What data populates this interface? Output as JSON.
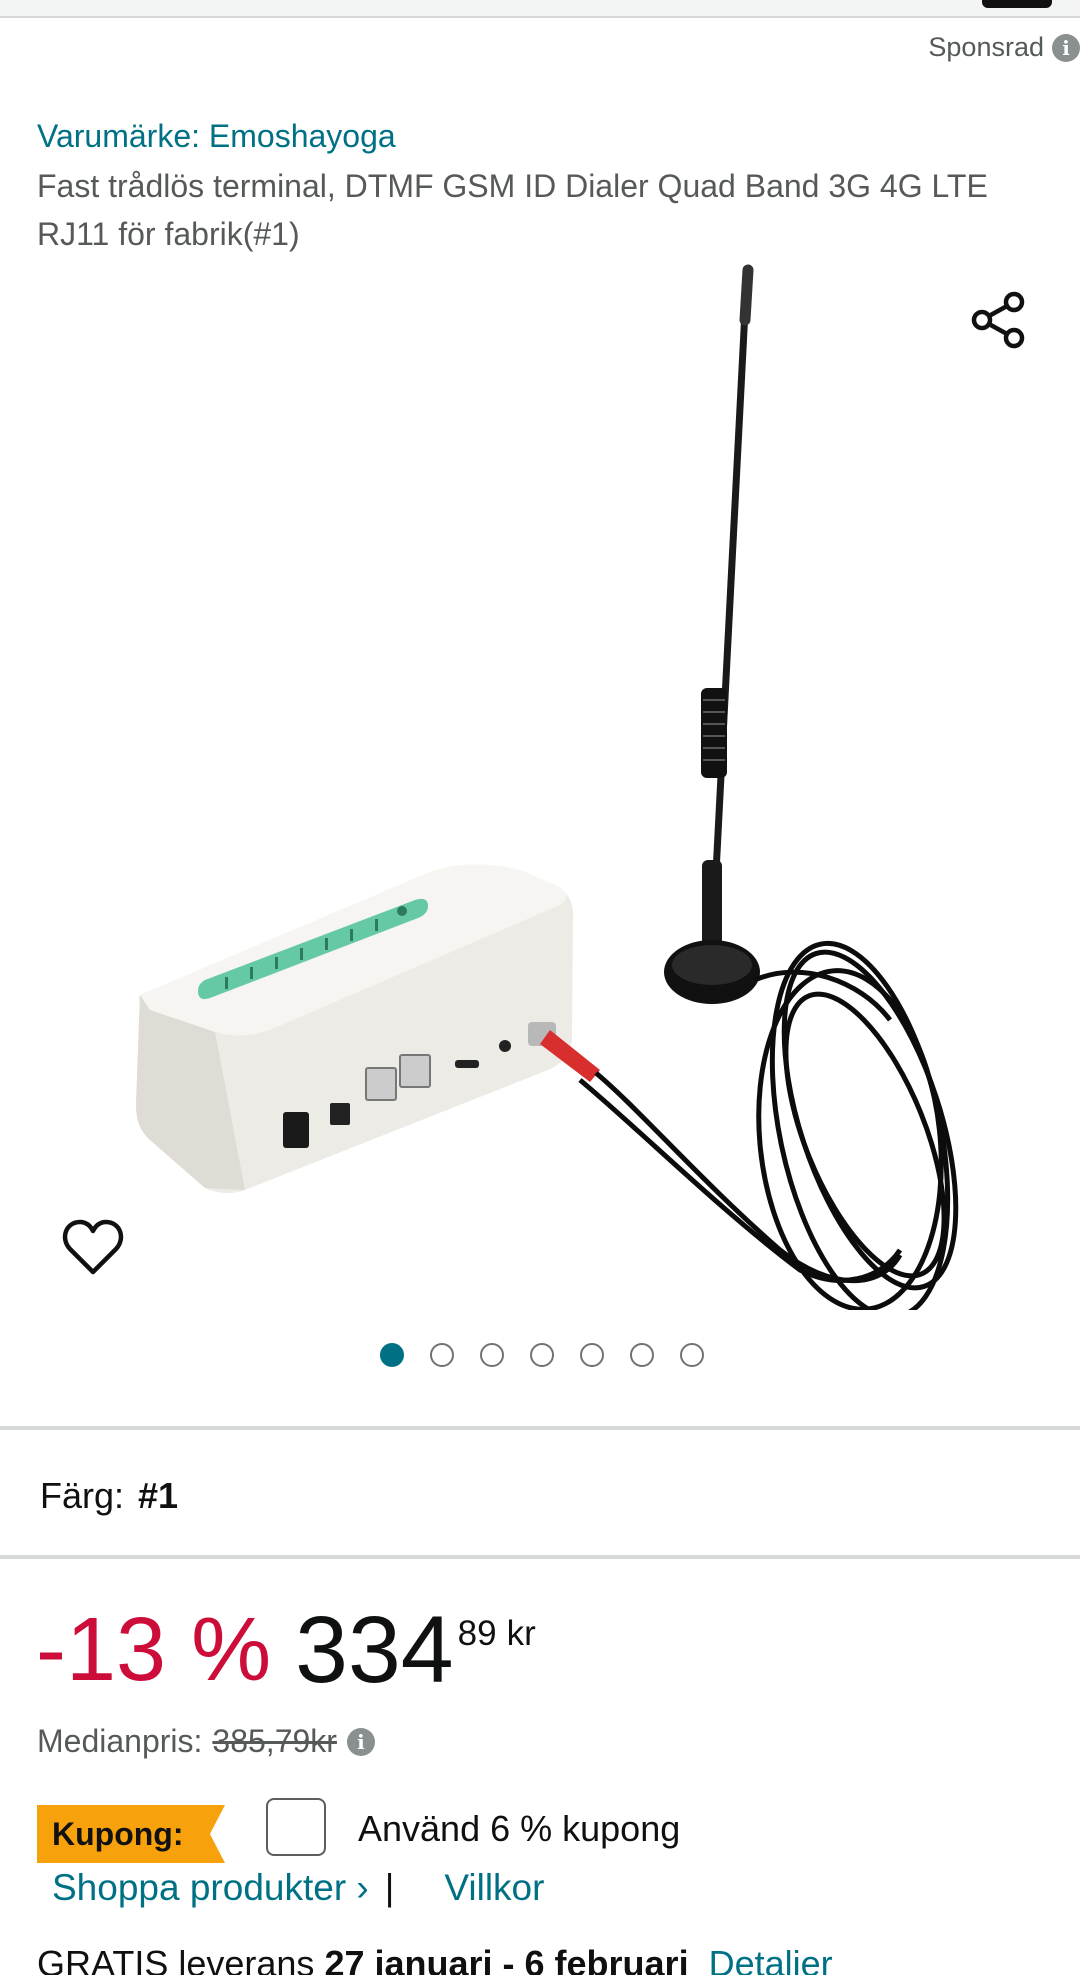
{
  "sponsored": {
    "label": "Sponsrad"
  },
  "product": {
    "brand": "Varumärke: Emoshayoga",
    "title": "Fast trådlös terminal, DTMF GSM ID Dialer Quad Band 3G 4G LTE RJ11 för fabrik(#1)"
  },
  "gallery": {
    "image_count": 7,
    "active_index": 0
  },
  "variant": {
    "label": "Färg:",
    "value": "#1"
  },
  "price": {
    "discount": "-13 %",
    "whole": "334",
    "fraction": "89",
    "currency": "kr",
    "median_label": "Medianpris:",
    "median_value": "385,79kr"
  },
  "coupon": {
    "badge": "Kupong:",
    "text": "Använd 6 % kupong",
    "checked": false
  },
  "links": {
    "shop": "Shoppa produkter ›",
    "separator": "|",
    "terms": "Villkor"
  },
  "delivery": {
    "prefix": "GRATIS leverans",
    "dates": "27 januari - 6 februari",
    "details_link": "Detaljer"
  },
  "colors": {
    "accent": "#007185",
    "discount": "#cc0c39",
    "coupon": "#f7a10d"
  },
  "icons": {
    "share": "share-icon",
    "favorite": "heart-icon",
    "info": "info-icon"
  }
}
